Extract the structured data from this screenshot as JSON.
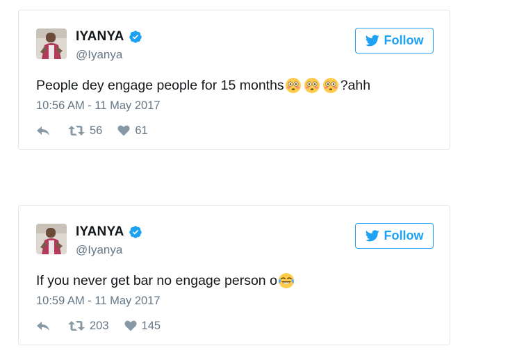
{
  "tweets": [
    {
      "name": "IYANYA",
      "handle": "@Iyanya",
      "follow_label": "Follow",
      "text": "People dey engage people for 15 months",
      "text_suffix": "?ahh",
      "emojis": [
        "flushed-face-emoji",
        "flushed-face-emoji",
        "flushed-face-emoji"
      ],
      "timestamp": "10:56 AM - 11 May 2017",
      "retweets": "56",
      "likes": "61"
    },
    {
      "name": "IYANYA",
      "handle": "@Iyanya",
      "follow_label": "Follow",
      "text": "If you never get bar no engage person o",
      "text_suffix": "",
      "emojis": [
        "face-with-tears-of-joy-emoji"
      ],
      "timestamp": "10:59 AM - 11 May 2017",
      "retweets": "203",
      "likes": "145"
    }
  ],
  "colors": {
    "twitter_blue": "#1da1f2",
    "verified_blue": "#1da1f2",
    "secondary_text": "#657786",
    "border": "#e1e8ed"
  },
  "icons": [
    "verified-badge-icon",
    "twitter-bird-icon",
    "reply-icon",
    "retweet-icon",
    "heart-icon"
  ]
}
